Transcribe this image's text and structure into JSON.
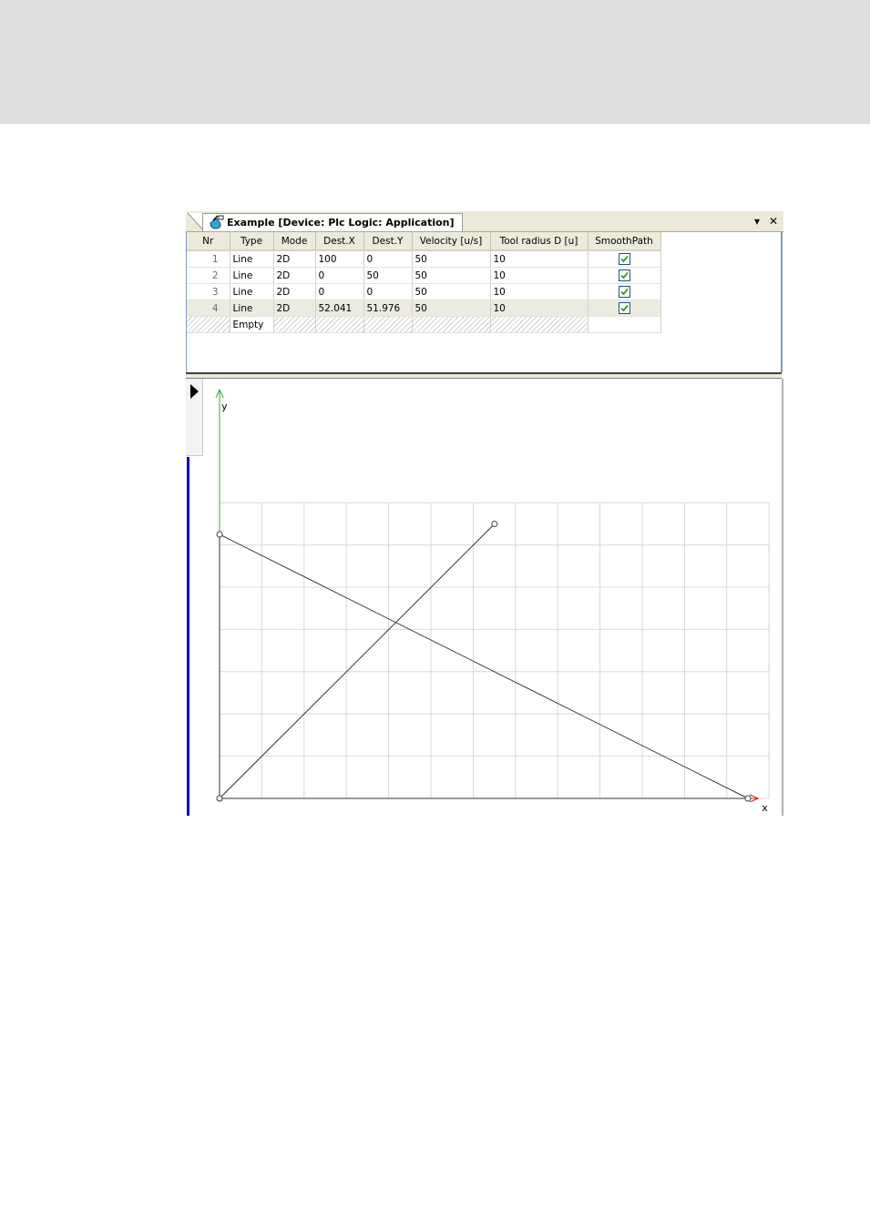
{
  "window": {
    "tab_title": "Example [Device: Plc Logic: Application]",
    "icons": {
      "tab": "cam-editor-icon",
      "dropdown": "dropdown-arrow-icon",
      "close": "close-icon"
    },
    "dropdown_glyph": "▾",
    "close_glyph": "✕"
  },
  "grid": {
    "columns": [
      "Nr",
      "Type",
      "Mode",
      "Dest.X",
      "Dest.Y",
      "Velocity [u/s]",
      "Tool radius D [u]",
      "SmoothPath"
    ],
    "rows": [
      {
        "nr": "1",
        "type": "Line",
        "mode": "2D",
        "dest_x": "100",
        "dest_y": "0",
        "velocity": "50",
        "tool_radius": "10",
        "smooth_path": true,
        "selected": false
      },
      {
        "nr": "2",
        "type": "Line",
        "mode": "2D",
        "dest_x": "0",
        "dest_y": "50",
        "velocity": "50",
        "tool_radius": "10",
        "smooth_path": true,
        "selected": false
      },
      {
        "nr": "3",
        "type": "Line",
        "mode": "2D",
        "dest_x": "0",
        "dest_y": "0",
        "velocity": "50",
        "tool_radius": "10",
        "smooth_path": true,
        "selected": false
      },
      {
        "nr": "4",
        "type": "Line",
        "mode": "2D",
        "dest_x": "52.041",
        "dest_y": "51.976",
        "velocity": "50",
        "tool_radius": "10",
        "smooth_path": true,
        "selected": true
      }
    ],
    "empty_row": {
      "type": "Empty"
    }
  },
  "plot": {
    "x_axis_label": "x",
    "y_axis_label": "y",
    "path_points": [
      [
        0,
        0
      ],
      [
        100,
        0
      ],
      [
        0,
        50
      ],
      [
        0,
        0
      ],
      [
        52.041,
        51.976
      ]
    ],
    "x_range": [
      0,
      104
    ],
    "y_range": [
      0,
      56
    ],
    "grid_step": 8,
    "colors": {
      "x_axis": "#cc2222",
      "y_axis": "#33aa33",
      "path": "#333333",
      "grid": "#d8d8d8"
    }
  }
}
